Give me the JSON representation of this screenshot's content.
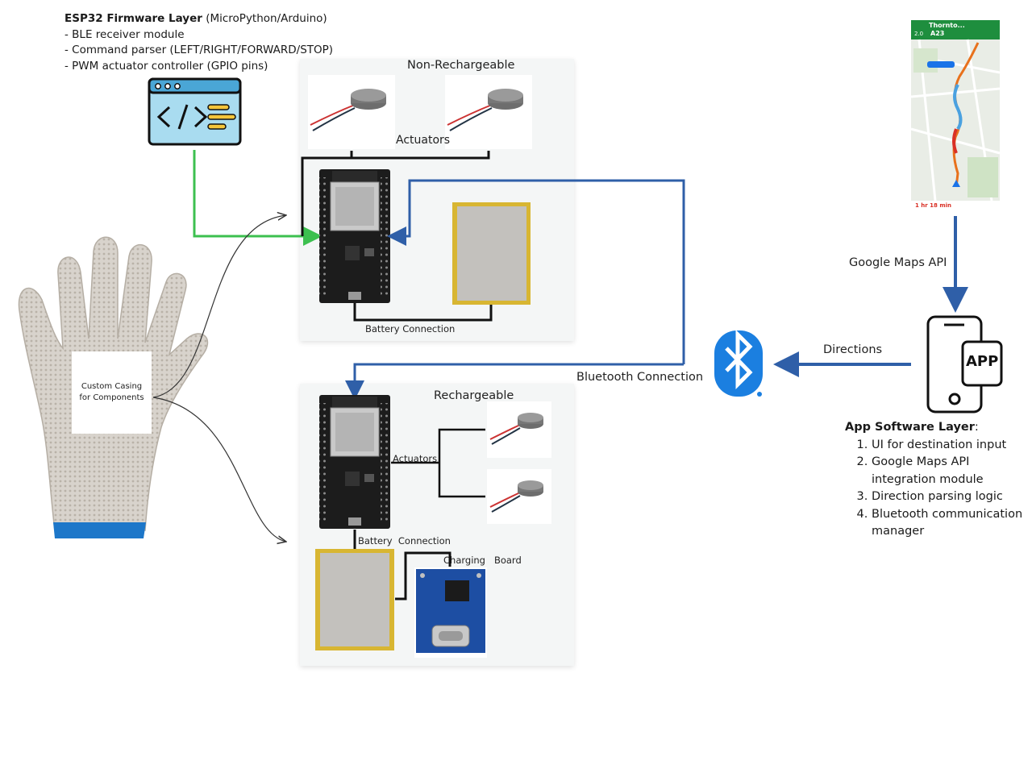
{
  "firmware": {
    "title": "ESP32 Firmware Layer",
    "title_suffix": " (MicroPython/Arduino)",
    "items": [
      "- BLE receiver module",
      "- Command parser (LEFT/RIGHT/FORWARD/STOP)",
      "- PWM actuator controller (GPIO pins)"
    ]
  },
  "non_rechargeable": {
    "title": "Non-Rechargeable",
    "actuators_label": "Actuators",
    "battery_connection_label": "Battery Connection"
  },
  "rechargeable": {
    "title": "Rechargeable",
    "actuators_label": "Actuators",
    "battery_connection_label": "Battery  Connection",
    "charging_board_label": "Charging   Board"
  },
  "glove": {
    "casing_label": "Custom Casing for Components"
  },
  "connections": {
    "bluetooth": "Bluetooth Connection",
    "directions": "Directions",
    "maps_api": "Google Maps API"
  },
  "map_screen": {
    "destination": "Thornto...",
    "road": "A23",
    "distance": "2.0",
    "eta": "1 hr 18 min"
  },
  "app_icon": {
    "label": "APP"
  },
  "app_layer": {
    "title": "App Software Layer",
    "title_suffix": ":",
    "items": [
      "UI for destination input",
      "Google Maps API integration module",
      "Direction parsing logic",
      "Bluetooth communication manager"
    ]
  },
  "colors": {
    "green_arrow": "#3cc04f",
    "blue_line": "#2f5fa8",
    "bluetooth_blue": "#1b7fe0",
    "panel_bg": "#f4f6f6",
    "board_black": "#1c1c1c",
    "battery_yellow": "#d8b632",
    "code_icon_bg": "#a9dcf0"
  }
}
